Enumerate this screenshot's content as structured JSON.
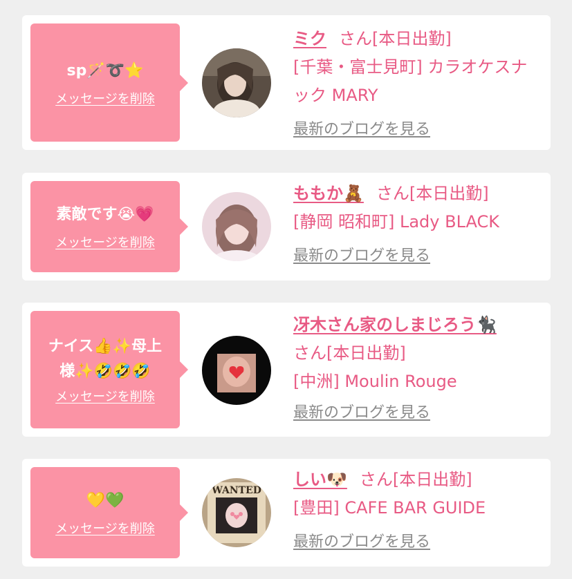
{
  "cards": [
    {
      "message_line1": "sp🪄➰⭐️",
      "message_line2": "",
      "delete_label": "メッセージを削除",
      "name": "ミク",
      "status": "さん[本日出勤]",
      "shop": "[千葉・富士見町] カラオケスナック MARY",
      "blog_label": "最新のブログを見る"
    },
    {
      "message_line1": "素敵です😭💗",
      "message_line2": "",
      "delete_label": "メッセージを削除",
      "name": "ももか🧸",
      "status": "さん[本日出勤]",
      "shop": "[静岡 昭和町] Lady BLACK",
      "blog_label": "最新のブログを見る"
    },
    {
      "message_line1": "ナイス👍✨母上",
      "message_line2": "様✨🤣🤣🤣",
      "delete_label": "メッセージを削除",
      "name": "冴木さん家のしまじろう🐈‍⬛",
      "status": "さん[本日出勤]",
      "shop": "[中洲] Moulin Rouge",
      "blog_label": "最新のブログを見る"
    },
    {
      "message_line1": "💛💚",
      "message_line2": "",
      "delete_label": "メッセージを削除",
      "name": "しい🐶",
      "status": "さん[本日出勤]",
      "shop": "[豊田] CAFE BAR GUIDE",
      "blog_label": "最新のブログを見る"
    }
  ],
  "avatar4_sign_text": "WANTED",
  "colors": {
    "bubble": "#fb93a5",
    "accent_text": "#e85a84",
    "link_gray": "#8a8a8a",
    "page_bg": "#efefef",
    "card_bg": "#ffffff"
  }
}
